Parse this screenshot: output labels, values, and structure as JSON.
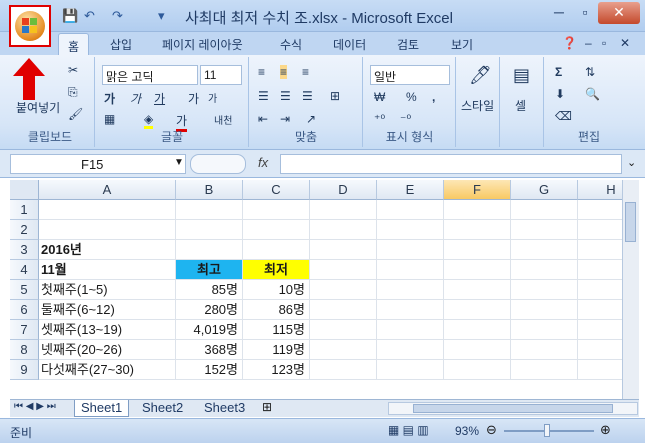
{
  "window": {
    "title": "사최대 최저 수치 조.xlsx - Microsoft Excel"
  },
  "tabs": [
    "홈",
    "삽입",
    "페이지 레이아웃",
    "수식",
    "데이터",
    "검토",
    "보기"
  ],
  "ribbon": {
    "clipboard": {
      "paste_label": "붙여넣기",
      "group_label": "클립보드"
    },
    "font": {
      "name": "맑은 고딕",
      "size": "11",
      "group_label": "글꼴",
      "bold": "가",
      "italic": "가",
      "underline": "가",
      "grow": "가",
      "shrink": "가",
      "color_a": "가",
      "phonetic": "내천"
    },
    "alignment": {
      "group_label": "맞춤"
    },
    "number": {
      "format": "일반",
      "group_label": "표시 형식",
      "currency": "₩",
      "percent": "%",
      "comma": ","
    },
    "styles": {
      "label": "스타일"
    },
    "cells": {
      "label": "셀"
    },
    "editing": {
      "group_label": "편집",
      "sum": "Σ"
    }
  },
  "formula_bar": {
    "name_box": "F15",
    "fx": "fx",
    "value": ""
  },
  "columns": [
    "A",
    "B",
    "C",
    "D",
    "E",
    "F",
    "G",
    "H"
  ],
  "selected_column": "F",
  "rows": [
    "1",
    "2",
    "3",
    "4",
    "5",
    "6",
    "7",
    "8",
    "9"
  ],
  "cells": {
    "A3": "2016년",
    "A4": "11월",
    "B4": "최고",
    "C4": "최저",
    "A5": "첫째주(1~5)",
    "B5": "85명",
    "C5": "10명",
    "A6": "둘째주(6~12)",
    "B6": "280명",
    "C6": "86명",
    "A7": "셋째주(13~19)",
    "B7": "4,019명",
    "C7": "115명",
    "A8": "넷째주(20~26)",
    "B8": "368명",
    "C8": "119명",
    "A9": "다섯째주(27~30)",
    "B9": "152명",
    "C9": "123명"
  },
  "colors": {
    "header_max": "#1eb4f0",
    "header_min": "#ffff00",
    "annotation": "#e00000"
  },
  "sheets": [
    "Sheet1",
    "Sheet2",
    "Sheet3"
  ],
  "active_sheet": "Sheet1",
  "status": {
    "ready": "준비",
    "zoom": "93%"
  }
}
